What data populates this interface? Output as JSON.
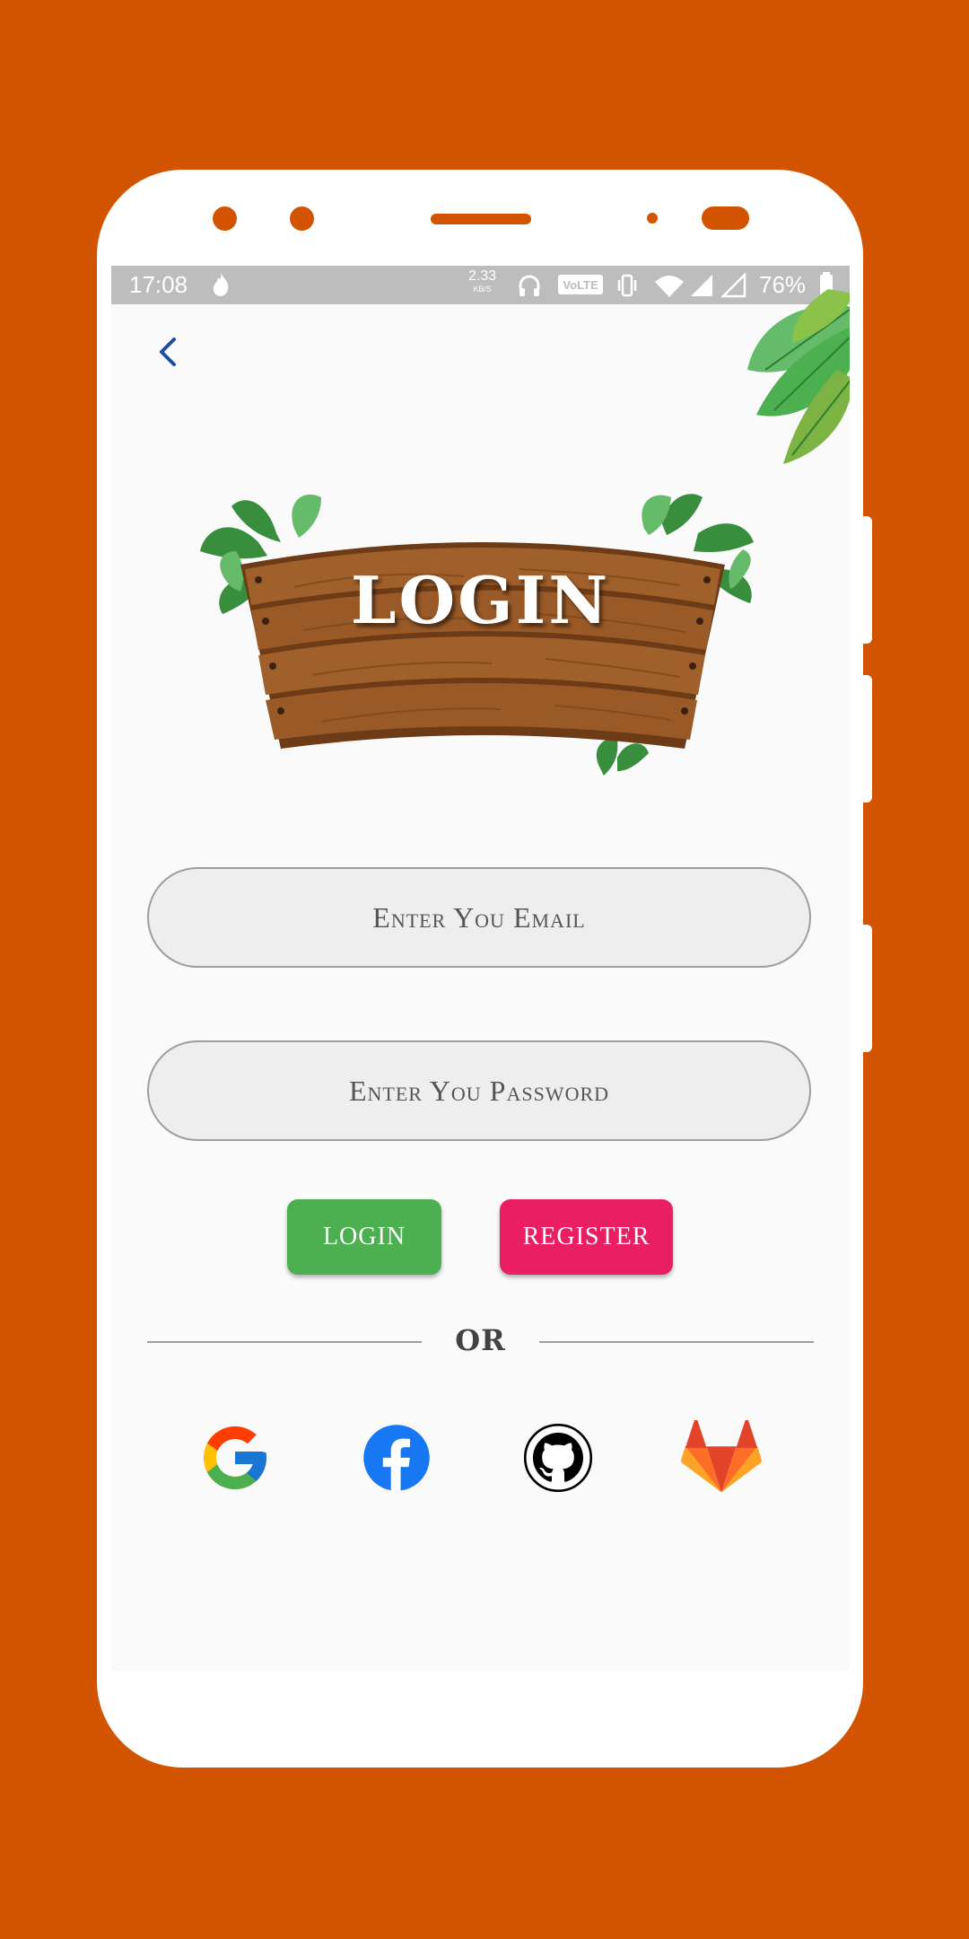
{
  "status_bar": {
    "time": "17:08",
    "net_speed": "2.33",
    "net_speed_unit": "KB/S",
    "volte_label": "VoLTE",
    "battery": "76%"
  },
  "login": {
    "title": "LOGIN",
    "email_placeholder": "Enter You Email",
    "password_placeholder": "Enter You Password",
    "login_button": "LOGIN",
    "register_button": "REGISTER",
    "or_label": "OR"
  },
  "social": [
    "google-icon",
    "facebook-icon",
    "github-icon",
    "gitlab-icon"
  ],
  "colors": {
    "background": "#D35400",
    "login_button": "#4CAF50",
    "register_button": "#E91E63",
    "back_arrow": "#1E4FA0",
    "facebook": "#1877F2"
  }
}
